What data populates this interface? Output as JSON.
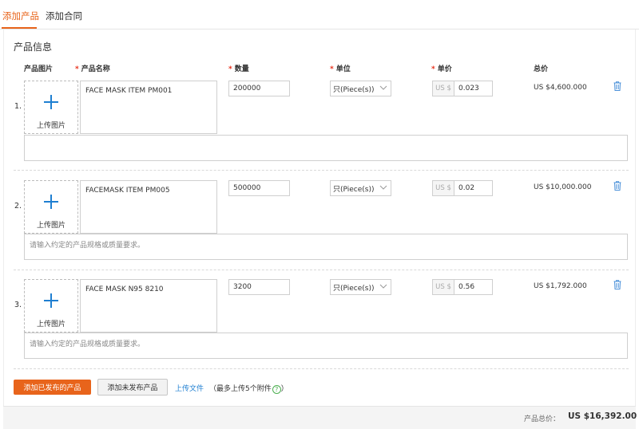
{
  "tabs": [
    "添加产品",
    "添加合同"
  ],
  "section_title": "产品信息",
  "columns": {
    "image": "产品图片",
    "name": "产品名称",
    "quantity": "数量",
    "unit": "单位",
    "price": "单价",
    "total": "总价",
    "required_mark": "*"
  },
  "upload_label": "上传图片",
  "currency_prefix": "US $",
  "requirements_placeholder": "请输入约定的产品规格或质量要求。",
  "products": [
    {
      "num": "1.",
      "name": "FACE MASK ITEM PM001",
      "quantity": "200000",
      "unit": "只(Piece(s))",
      "price": "0.023",
      "total": "US $4,600.000",
      "requirements": ""
    },
    {
      "num": "2.",
      "name": "FACEMASK ITEM PM005",
      "quantity": "500000",
      "unit": "只(Piece(s))",
      "price": "0.02",
      "total": "US $10,000.000",
      "requirements": "请输入约定的产品规格或质量要求。"
    },
    {
      "num": "3.",
      "name": "FACE MASK N95 8210",
      "quantity": "3200",
      "unit": "只(Piece(s))",
      "price": "0.56",
      "total": "US $1,792.000",
      "requirements": "请输入约定的产品规格或质量要求。"
    }
  ],
  "actions": {
    "add_published": "添加已发布的产品",
    "add_unpublished": "添加未发布产品",
    "upload_file": "上传文件",
    "upload_hint": "（最多上传5个附件",
    "upload_hint_end": "）",
    "help_glyph": "?"
  },
  "footer": {
    "label": "产品总价：",
    "value": "US $16,392.00"
  },
  "colors": {
    "accent": "#e8641b",
    "link": "#1f7fd1",
    "required": "#e8301b"
  }
}
